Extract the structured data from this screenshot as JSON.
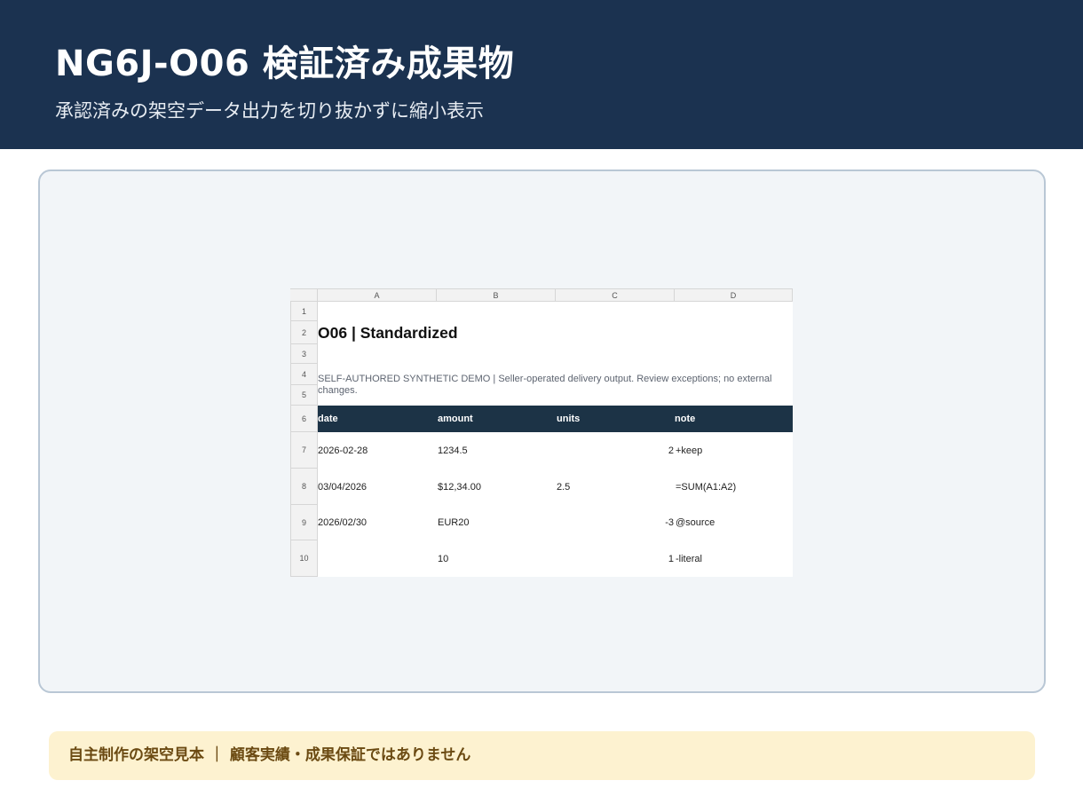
{
  "header": {
    "title": "NG6J-O06 検証済み成果物",
    "subtitle": "承認済みの架空データ出力を切り抜かずに縮小表示"
  },
  "sheet": {
    "columns": [
      "A",
      "B",
      "C",
      "D"
    ],
    "rows": [
      "1",
      "2",
      "3",
      "4",
      "5",
      "6",
      "7",
      "8",
      "9",
      "10"
    ],
    "title": "O06 | Standardized",
    "description": "SELF-AUTHORED SYNTHETIC DEMO | Seller-operated delivery output. Review exceptions; no external changes.",
    "table_headers": [
      "date",
      "amount",
      "units",
      "note"
    ],
    "table_rows": [
      [
        "2026-02-28",
        "1234.5",
        "",
        "2",
        "+keep"
      ],
      [
        "03/04/2026",
        "$12,34.00",
        "2.5",
        "",
        "=SUM(A1:A2)"
      ],
      [
        "2026/02/30",
        "EUR20",
        "",
        "-3",
        "@source"
      ],
      [
        "",
        "10",
        "",
        "1",
        "-literal"
      ]
    ]
  },
  "footer_note": "自主制作の架空見本 ｜ 顧客実績・成果保証ではありません",
  "colors": {
    "header_bg": "#1b3250",
    "panel_bg": "#f2f5f8",
    "table_header_bg": "#1c3346",
    "note_bg": "#fdf2d0",
    "note_text": "#6b4a12"
  }
}
